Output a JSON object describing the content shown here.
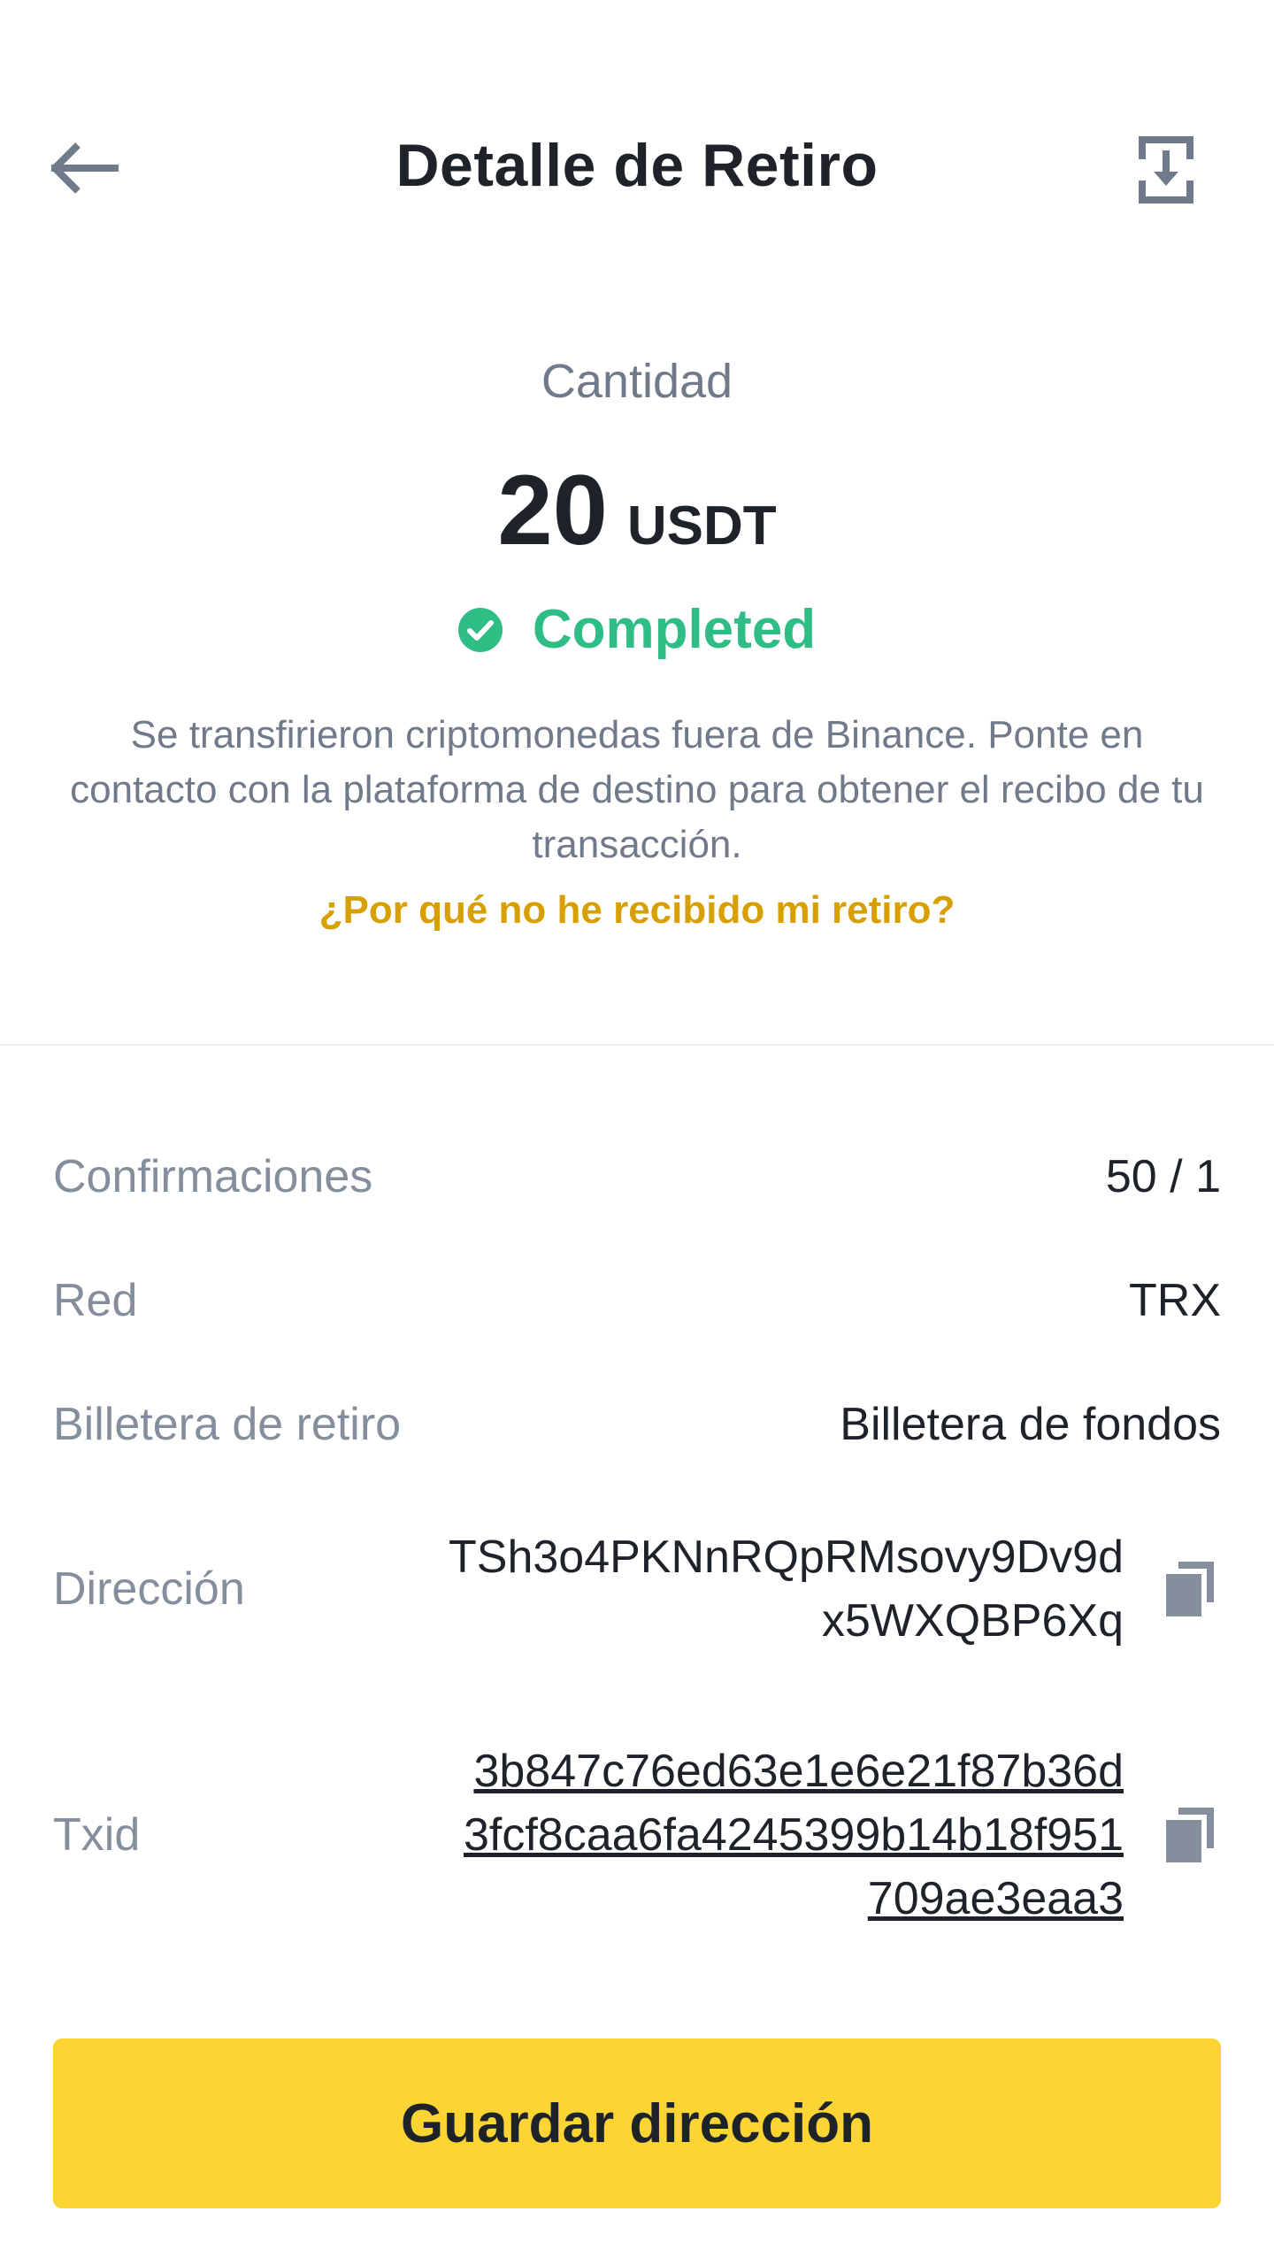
{
  "header": {
    "title": "Detalle de Retiro"
  },
  "amount": {
    "label": "Cantidad",
    "value": "20",
    "unit": "USDT"
  },
  "status": {
    "text": "Completed",
    "color": "#2ebd85"
  },
  "description": "Se transfirieron criptomonedas fuera de Binance. Ponte en contacto con la plataforma de destino para obtener el recibo de tu transacción.",
  "why_link": "¿Por qué no he recibido mi retiro?",
  "details": {
    "confirmations": {
      "label": "Confirmaciones",
      "value": "50 / 1"
    },
    "network": {
      "label": "Red",
      "value": "TRX"
    },
    "wallet": {
      "label": "Billetera de retiro",
      "value": "Billetera de fondos"
    },
    "address": {
      "label": "Dirección",
      "line1": "TSh3o4PKNnRQpRMsovy9Dv9d",
      "line2": "x5WXQBP6Xq"
    },
    "txid": {
      "label": "Txid",
      "line1": "3b847c76ed63e1e6e21f87b36d",
      "line2": "3fcf8caa6fa4245399b14b18f951",
      "line3": "709ae3eaa3"
    }
  },
  "save_button": "Guardar dirección",
  "colors": {
    "accent": "#fcd535",
    "link": "#d89f00",
    "success": "#2ebd85"
  },
  "icons": {
    "back": "arrow-left-icon",
    "download": "download-icon",
    "status": "check-circle-icon",
    "copy": "copy-icon"
  }
}
